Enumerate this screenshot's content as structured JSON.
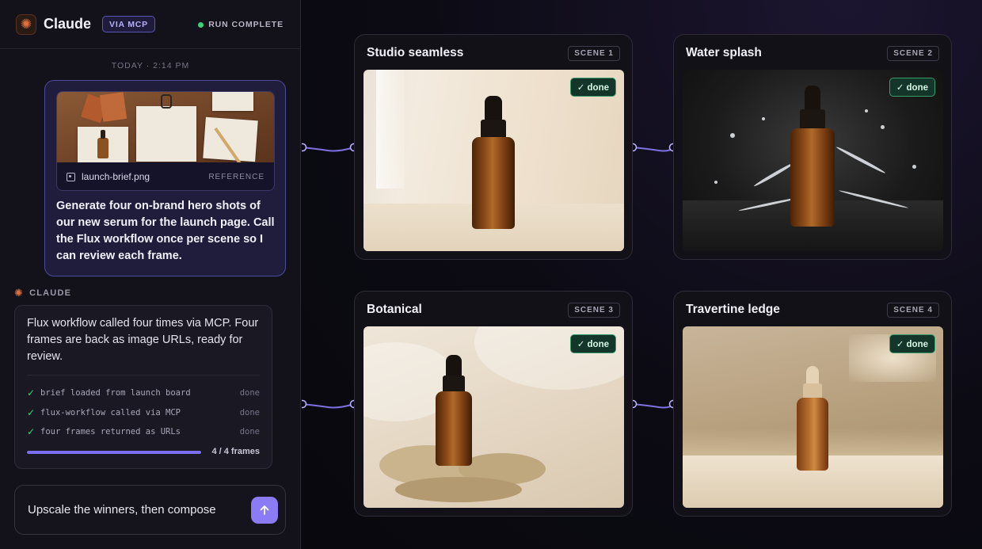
{
  "header": {
    "app_title": "Claude",
    "mcp_badge": "VIA MCP",
    "run_status": "RUN COMPLETE"
  },
  "chat": {
    "timestamp": "TODAY · 2:14 PM",
    "user_message": {
      "attachment": {
        "filename": "launch-brief.png",
        "label": "REFERENCE"
      },
      "text": "Generate four on-brand hero shots of our new serum for the launch page. Call the Flux workflow once per scene so I can review each frame."
    },
    "assistant_label": "CLAUDE",
    "assistant_reply": {
      "text": "Flux workflow called four times via MCP. Four frames are back as image URLs, ready for review.",
      "steps": [
        {
          "label": "brief loaded from launch board",
          "status": "done"
        },
        {
          "label": "flux-workflow called via MCP",
          "status": "done"
        },
        {
          "label": "four frames returned as URLs",
          "status": "done"
        }
      ],
      "progress": {
        "fraction": 1.0,
        "label": "4 / 4 frames"
      }
    },
    "composer": {
      "value": "Upscale the winners, then compose"
    }
  },
  "scenes": [
    {
      "title": "Studio seamless",
      "tag": "SCENE 1",
      "status": "✓ done"
    },
    {
      "title": "Water splash",
      "tag": "SCENE 2",
      "status": "✓ done"
    },
    {
      "title": "Botanical",
      "tag": "SCENE 3",
      "status": "✓ done"
    },
    {
      "title": "Travertine ledge",
      "tag": "SCENE 4",
      "status": "✓ done"
    }
  ],
  "icons": {
    "logo": "claude-asterisk-icon",
    "attachment": "image-icon",
    "send": "arrow-up-icon",
    "step_check": "check-icon"
  },
  "colors": {
    "accent": "#8b7cf6",
    "success": "#3ccf7a",
    "brand": "#e0703f"
  }
}
